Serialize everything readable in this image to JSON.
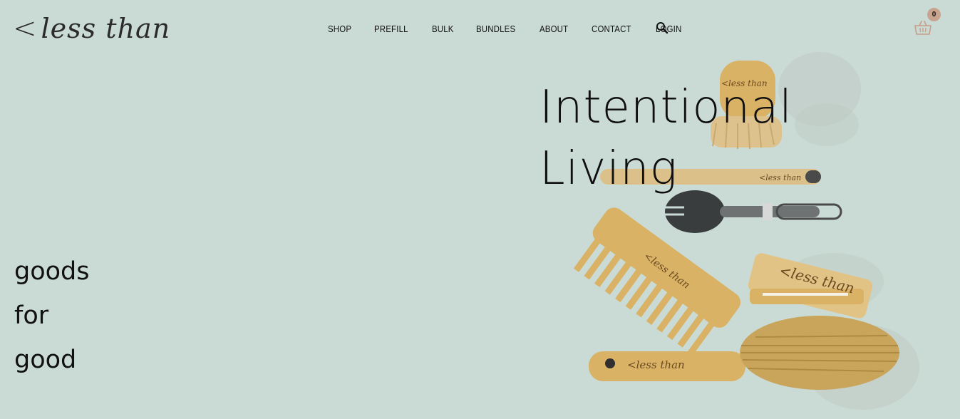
{
  "brand": {
    "chevron": "<",
    "name": "less than"
  },
  "nav": {
    "items": [
      {
        "label": "SHOP"
      },
      {
        "label": "PREFILL"
      },
      {
        "label": "BULK"
      },
      {
        "label": "BUNDLES"
      },
      {
        "label": "ABOUT"
      },
      {
        "label": "CONTACT"
      },
      {
        "label": "LOGIN"
      }
    ]
  },
  "header": {
    "search_icon": "search-icon",
    "cart_icon": "basket-icon",
    "cart_count": "0"
  },
  "hero": {
    "headline_line1": "Intentional",
    "headline_line2": "Living",
    "tagline": [
      "goods",
      "for",
      "good"
    ],
    "product_engraving": "<less than"
  },
  "colors": {
    "background": "#cadbd5",
    "text": "#111111",
    "cart_badge": "#c8a48f",
    "cart_icon": "#c89d8a",
    "bamboo": "#d9b266"
  }
}
